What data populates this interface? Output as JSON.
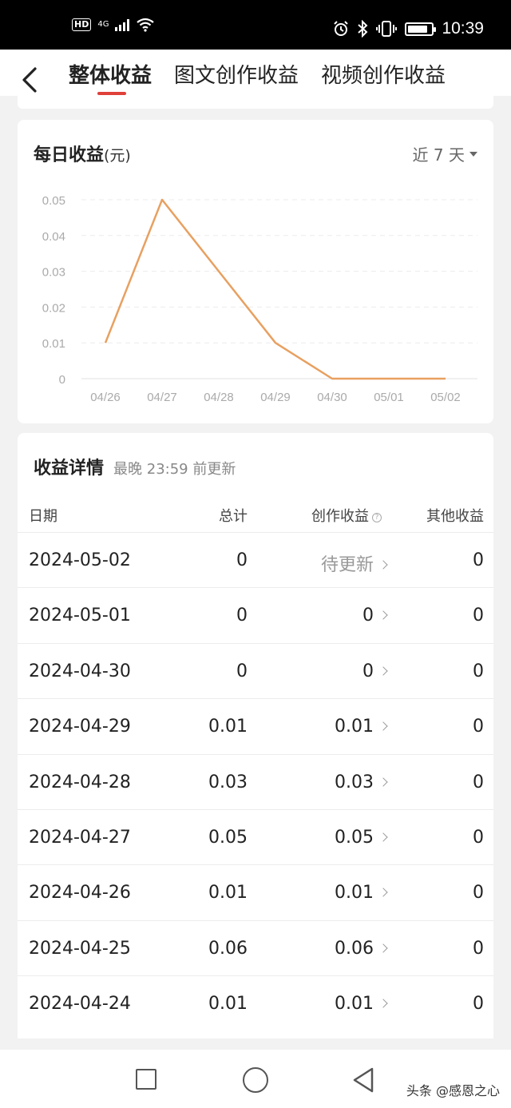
{
  "status_bar": {
    "hd": "HD",
    "network": "4G",
    "time": "10:39",
    "icons": [
      "signal-icon",
      "wifi-icon",
      "alarm-icon",
      "bluetooth-icon",
      "vibrate-icon",
      "battery-icon"
    ]
  },
  "nav": {
    "back_icon": "chevron-left-icon",
    "tabs": [
      {
        "label": "整体收益",
        "active": true
      },
      {
        "label": "图文创作收益",
        "active": false
      },
      {
        "label": "视频创作收益",
        "active": false
      }
    ]
  },
  "daily_card": {
    "title": "每日收益",
    "unit": "(元)",
    "range": "近 7 天"
  },
  "chart_data": {
    "type": "line",
    "title": "每日收益(元)",
    "categories": [
      "04/26",
      "04/27",
      "04/28",
      "04/29",
      "04/30",
      "05/01",
      "05/02"
    ],
    "values": [
      0.01,
      0.05,
      0.03,
      0.01,
      0,
      0,
      0
    ],
    "y_ticks": [
      "0",
      "0.01",
      "0.02",
      "0.03",
      "0.04",
      "0.05"
    ],
    "ylim": [
      0,
      0.05
    ],
    "grid": true,
    "line_color": "#e8a060"
  },
  "detail": {
    "title": "收益详情",
    "note": "最晚 23:59 前更新",
    "headers": {
      "date": "日期",
      "total": "总计",
      "creation": "创作收益",
      "other": "其他收益"
    },
    "rows": [
      {
        "date": "2024-05-02",
        "total": "0",
        "creation": "待更新",
        "other": "0"
      },
      {
        "date": "2024-05-01",
        "total": "0",
        "creation": "0",
        "other": "0"
      },
      {
        "date": "2024-04-30",
        "total": "0",
        "creation": "0",
        "other": "0"
      },
      {
        "date": "2024-04-29",
        "total": "0.01",
        "creation": "0.01",
        "other": "0"
      },
      {
        "date": "2024-04-28",
        "total": "0.03",
        "creation": "0.03",
        "other": "0"
      },
      {
        "date": "2024-04-27",
        "total": "0.05",
        "creation": "0.05",
        "other": "0"
      },
      {
        "date": "2024-04-26",
        "total": "0.01",
        "creation": "0.01",
        "other": "0"
      },
      {
        "date": "2024-04-25",
        "total": "0.06",
        "creation": "0.06",
        "other": "0"
      },
      {
        "date": "2024-04-24",
        "total": "0.01",
        "creation": "0.01",
        "other": "0"
      }
    ]
  },
  "system_nav": {
    "icons": [
      "recent-apps-icon",
      "home-icon",
      "back-icon"
    ]
  },
  "watermark": "头条 @感恩之心"
}
